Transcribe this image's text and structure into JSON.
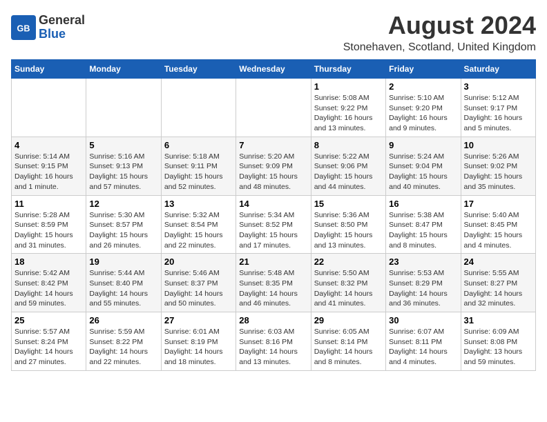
{
  "header": {
    "logo_general": "General",
    "logo_blue": "Blue",
    "month_year": "August 2024",
    "location": "Stonehaven, Scotland, United Kingdom"
  },
  "days_of_week": [
    "Sunday",
    "Monday",
    "Tuesday",
    "Wednesday",
    "Thursday",
    "Friday",
    "Saturday"
  ],
  "weeks": [
    [
      {
        "day": "",
        "info": ""
      },
      {
        "day": "",
        "info": ""
      },
      {
        "day": "",
        "info": ""
      },
      {
        "day": "",
        "info": ""
      },
      {
        "day": "1",
        "info": "Sunrise: 5:08 AM\nSunset: 9:22 PM\nDaylight: 16 hours\nand 13 minutes."
      },
      {
        "day": "2",
        "info": "Sunrise: 5:10 AM\nSunset: 9:20 PM\nDaylight: 16 hours\nand 9 minutes."
      },
      {
        "day": "3",
        "info": "Sunrise: 5:12 AM\nSunset: 9:17 PM\nDaylight: 16 hours\nand 5 minutes."
      }
    ],
    [
      {
        "day": "4",
        "info": "Sunrise: 5:14 AM\nSunset: 9:15 PM\nDaylight: 16 hours\nand 1 minute."
      },
      {
        "day": "5",
        "info": "Sunrise: 5:16 AM\nSunset: 9:13 PM\nDaylight: 15 hours\nand 57 minutes."
      },
      {
        "day": "6",
        "info": "Sunrise: 5:18 AM\nSunset: 9:11 PM\nDaylight: 15 hours\nand 52 minutes."
      },
      {
        "day": "7",
        "info": "Sunrise: 5:20 AM\nSunset: 9:09 PM\nDaylight: 15 hours\nand 48 minutes."
      },
      {
        "day": "8",
        "info": "Sunrise: 5:22 AM\nSunset: 9:06 PM\nDaylight: 15 hours\nand 44 minutes."
      },
      {
        "day": "9",
        "info": "Sunrise: 5:24 AM\nSunset: 9:04 PM\nDaylight: 15 hours\nand 40 minutes."
      },
      {
        "day": "10",
        "info": "Sunrise: 5:26 AM\nSunset: 9:02 PM\nDaylight: 15 hours\nand 35 minutes."
      }
    ],
    [
      {
        "day": "11",
        "info": "Sunrise: 5:28 AM\nSunset: 8:59 PM\nDaylight: 15 hours\nand 31 minutes."
      },
      {
        "day": "12",
        "info": "Sunrise: 5:30 AM\nSunset: 8:57 PM\nDaylight: 15 hours\nand 26 minutes."
      },
      {
        "day": "13",
        "info": "Sunrise: 5:32 AM\nSunset: 8:54 PM\nDaylight: 15 hours\nand 22 minutes."
      },
      {
        "day": "14",
        "info": "Sunrise: 5:34 AM\nSunset: 8:52 PM\nDaylight: 15 hours\nand 17 minutes."
      },
      {
        "day": "15",
        "info": "Sunrise: 5:36 AM\nSunset: 8:50 PM\nDaylight: 15 hours\nand 13 minutes."
      },
      {
        "day": "16",
        "info": "Sunrise: 5:38 AM\nSunset: 8:47 PM\nDaylight: 15 hours\nand 8 minutes."
      },
      {
        "day": "17",
        "info": "Sunrise: 5:40 AM\nSunset: 8:45 PM\nDaylight: 15 hours\nand 4 minutes."
      }
    ],
    [
      {
        "day": "18",
        "info": "Sunrise: 5:42 AM\nSunset: 8:42 PM\nDaylight: 14 hours\nand 59 minutes."
      },
      {
        "day": "19",
        "info": "Sunrise: 5:44 AM\nSunset: 8:40 PM\nDaylight: 14 hours\nand 55 minutes."
      },
      {
        "day": "20",
        "info": "Sunrise: 5:46 AM\nSunset: 8:37 PM\nDaylight: 14 hours\nand 50 minutes."
      },
      {
        "day": "21",
        "info": "Sunrise: 5:48 AM\nSunset: 8:35 PM\nDaylight: 14 hours\nand 46 minutes."
      },
      {
        "day": "22",
        "info": "Sunrise: 5:50 AM\nSunset: 8:32 PM\nDaylight: 14 hours\nand 41 minutes."
      },
      {
        "day": "23",
        "info": "Sunrise: 5:53 AM\nSunset: 8:29 PM\nDaylight: 14 hours\nand 36 minutes."
      },
      {
        "day": "24",
        "info": "Sunrise: 5:55 AM\nSunset: 8:27 PM\nDaylight: 14 hours\nand 32 minutes."
      }
    ],
    [
      {
        "day": "25",
        "info": "Sunrise: 5:57 AM\nSunset: 8:24 PM\nDaylight: 14 hours\nand 27 minutes."
      },
      {
        "day": "26",
        "info": "Sunrise: 5:59 AM\nSunset: 8:22 PM\nDaylight: 14 hours\nand 22 minutes."
      },
      {
        "day": "27",
        "info": "Sunrise: 6:01 AM\nSunset: 8:19 PM\nDaylight: 14 hours\nand 18 minutes."
      },
      {
        "day": "28",
        "info": "Sunrise: 6:03 AM\nSunset: 8:16 PM\nDaylight: 14 hours\nand 13 minutes."
      },
      {
        "day": "29",
        "info": "Sunrise: 6:05 AM\nSunset: 8:14 PM\nDaylight: 14 hours\nand 8 minutes."
      },
      {
        "day": "30",
        "info": "Sunrise: 6:07 AM\nSunset: 8:11 PM\nDaylight: 14 hours\nand 4 minutes."
      },
      {
        "day": "31",
        "info": "Sunrise: 6:09 AM\nSunset: 8:08 PM\nDaylight: 13 hours\nand 59 minutes."
      }
    ]
  ]
}
